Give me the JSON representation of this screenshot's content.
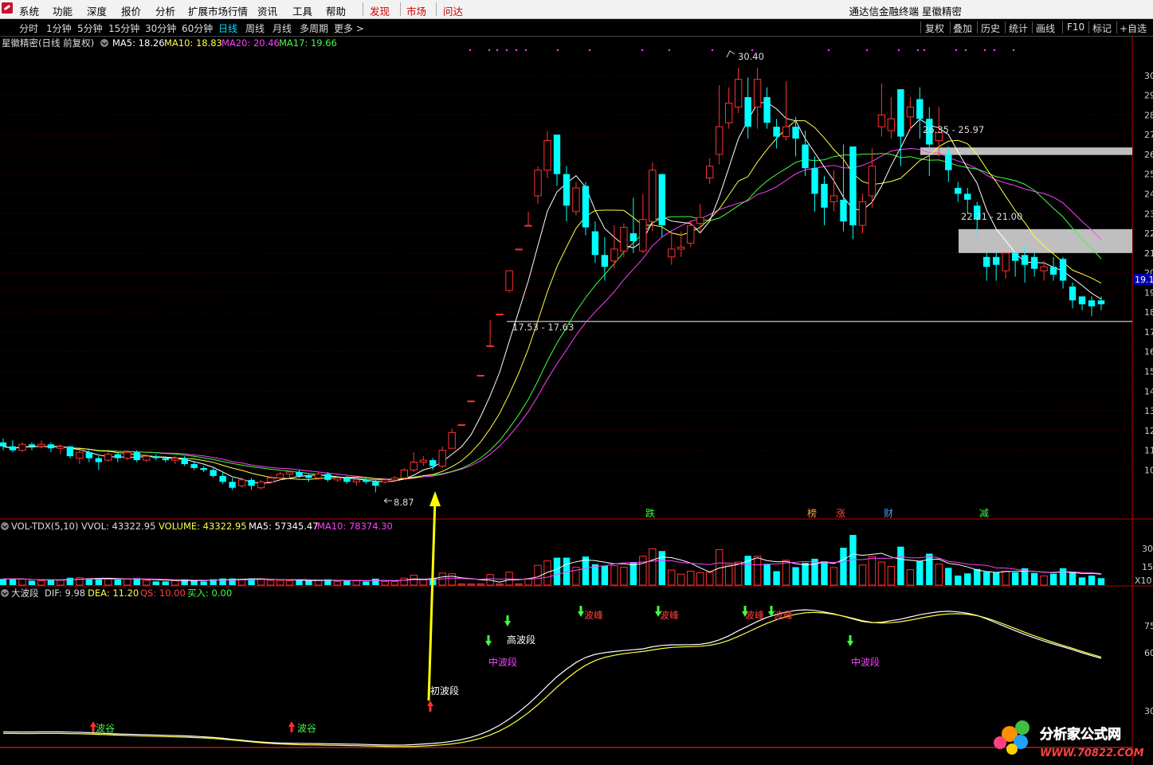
{
  "menu": {
    "items": [
      "系统",
      "功能",
      "深度",
      "报价",
      "分析",
      "扩展市场行情",
      "资讯",
      "工具",
      "帮助"
    ],
    "red_items": [
      "发现",
      "市场",
      "问达"
    ],
    "title": "通达信金融终端 星徽精密"
  },
  "periods": [
    "分时",
    "1分钟",
    "5分钟",
    "15分钟",
    "30分钟",
    "60分钟",
    "日线",
    "周线",
    "月线",
    "多周期",
    "更多 >"
  ],
  "active_period": "日线",
  "toolbar": [
    "复权",
    "叠加",
    "历史",
    "统计",
    "画线",
    "F10",
    "标记",
    "+自选"
  ],
  "main_chart": {
    "title": "星徽精密(日线 前复权)",
    "legend": [
      {
        "label": "MA5: 18.26",
        "color": "#ffffff"
      },
      {
        "label": "MA10: 18.83",
        "color": "#ffff40"
      },
      {
        "label": "MA20: 20.46",
        "color": "#ff40ff"
      },
      {
        "label": "MA17: 19.66",
        "color": "#40ff40"
      }
    ],
    "annotations": {
      "high": "30.40",
      "low": "8.87",
      "zone1": "26.35 - 25.97",
      "zone2": "22.21 - 21.00",
      "zone3": "17.53 - 17.63"
    },
    "current_price": "19.1",
    "y_ticks": [
      "30",
      "29",
      "28",
      "27",
      "26",
      "25",
      "24",
      "23",
      "22",
      "21",
      "20",
      "19",
      "18",
      "17",
      "16",
      "15",
      "14",
      "13",
      "12",
      "11",
      "10"
    ],
    "events": [
      {
        "label": "跌",
        "color": "#40ff40"
      },
      {
        "label": "榜",
        "color": "#ffa040"
      },
      {
        "label": "涨",
        "color": "#ff4040"
      },
      {
        "label": "财",
        "color": "#40a0ff"
      },
      {
        "label": "减",
        "color": "#40ff40"
      }
    ]
  },
  "volume_panel": {
    "name": "VOL-TDX(5,10)",
    "legend": [
      {
        "label": "VVOL: 43322.95",
        "color": "#dddddd"
      },
      {
        "label": "VOLUME: 43322.95",
        "color": "#ffff40"
      },
      {
        "label": "MA5: 57345.47",
        "color": "#ffffff"
      },
      {
        "label": "MA10: 78374.30",
        "color": "#ff40ff"
      }
    ],
    "y_ticks": [
      "30",
      "15",
      "X10"
    ]
  },
  "wave_panel": {
    "name": "大波段",
    "legend": [
      {
        "label": "DIF: 9.98",
        "color": "#dddddd"
      },
      {
        "label": "DEA: 11.20",
        "color": "#ffff40"
      },
      {
        "label": "QS: 10.00",
        "color": "#ff4040"
      },
      {
        "label": "买入: 0.00",
        "color": "#40ff40"
      }
    ],
    "labels": {
      "trough": "波谷",
      "peak": "波峰",
      "initial": "初波段",
      "middle": "中波段",
      "high": "高波段"
    },
    "y_ticks": [
      "75",
      "60",
      "30"
    ]
  },
  "watermark": {
    "name": "分析家公式网",
    "url": "WWW.70822.COM"
  },
  "chart_data": {
    "type": "candlestick",
    "title": "星徽精密(日线 前复权)",
    "ylim": [
      8,
      31
    ],
    "candles": [
      [
        11.4,
        11.2,
        11.6,
        11.0
      ],
      [
        11.2,
        11.0,
        11.5,
        10.9
      ],
      [
        11.0,
        11.3,
        11.4,
        10.9
      ],
      [
        11.3,
        11.2,
        11.4,
        11.0
      ],
      [
        11.2,
        11.3,
        11.5,
        11.1
      ],
      [
        11.3,
        11.1,
        11.4,
        10.9
      ],
      [
        11.1,
        11.2,
        11.3,
        10.8
      ],
      [
        11.2,
        10.7,
        11.2,
        10.6
      ],
      [
        10.6,
        10.9,
        11.0,
        10.3
      ],
      [
        10.9,
        10.6,
        11.0,
        10.4
      ],
      [
        10.6,
        10.4,
        10.7,
        10.0
      ],
      [
        10.5,
        10.8,
        10.9,
        10.4
      ],
      [
        10.8,
        10.6,
        10.9,
        10.4
      ],
      [
        10.6,
        10.9,
        11.0,
        10.5
      ],
      [
        10.9,
        10.5,
        11.0,
        10.4
      ],
      [
        10.5,
        10.7,
        10.8,
        10.4
      ],
      [
        10.7,
        10.6,
        10.8,
        10.5
      ],
      [
        10.6,
        10.5,
        10.7,
        10.4
      ],
      [
        10.5,
        10.6,
        10.7,
        10.3
      ],
      [
        10.6,
        10.3,
        10.7,
        10.2
      ],
      [
        10.3,
        10.1,
        10.4,
        10.0
      ],
      [
        10.1,
        10.0,
        10.2,
        9.9
      ],
      [
        10.0,
        9.7,
        10.1,
        9.6
      ],
      [
        9.7,
        9.4,
        9.9,
        9.3
      ],
      [
        9.4,
        9.1,
        9.6,
        9.0
      ],
      [
        9.2,
        9.5,
        9.6,
        9.1
      ],
      [
        9.5,
        9.2,
        9.6,
        9.0
      ],
      [
        9.1,
        9.4,
        9.5,
        9.0
      ],
      [
        9.4,
        9.6,
        9.7,
        9.3
      ],
      [
        9.6,
        9.8,
        9.9,
        9.5
      ],
      [
        9.8,
        9.9,
        10.0,
        9.6
      ],
      [
        9.9,
        9.7,
        10.0,
        9.6
      ],
      [
        9.7,
        9.6,
        9.8,
        9.4
      ],
      [
        9.6,
        9.8,
        9.9,
        9.5
      ],
      [
        9.8,
        9.5,
        9.9,
        9.4
      ],
      [
        9.5,
        9.6,
        9.7,
        9.4
      ],
      [
        9.6,
        9.4,
        9.7,
        9.3
      ],
      [
        9.4,
        9.5,
        9.6,
        9.2
      ],
      [
        9.5,
        9.4,
        9.6,
        9.3
      ],
      [
        9.4,
        9.2,
        9.5,
        8.87
      ],
      [
        9.4,
        9.5,
        9.6,
        9.3
      ],
      [
        9.5,
        9.6,
        9.7,
        9.4
      ],
      [
        9.6,
        10.0,
        10.1,
        9.5
      ],
      [
        10.0,
        10.4,
        10.9,
        9.9
      ],
      [
        10.4,
        10.5,
        10.7,
        10.2
      ],
      [
        10.5,
        10.2,
        10.6,
        10.0
      ],
      [
        10.2,
        11.0,
        11.2,
        10.1
      ],
      [
        11.1,
        11.9,
        12.1,
        11.1
      ],
      [
        12.3,
        12.3,
        12.3,
        12.3
      ],
      [
        13.5,
        13.5,
        13.5,
        13.5
      ],
      [
        14.8,
        14.8,
        14.8,
        14.8
      ],
      [
        16.3,
        16.3,
        17.6,
        16.3
      ],
      [
        17.9,
        17.9,
        17.9,
        17.9
      ],
      [
        19.1,
        20.1,
        20.1,
        19.0
      ],
      [
        21.2,
        21.2,
        21.2,
        21.2
      ],
      [
        22.4,
        22.4,
        23.1,
        22.4
      ],
      [
        23.9,
        25.2,
        25.4,
        23.5
      ],
      [
        25.2,
        26.7,
        27.2,
        24.8
      ],
      [
        27.0,
        25.0,
        27.0,
        24.4
      ],
      [
        25.0,
        23.4,
        25.4,
        22.6
      ],
      [
        23.1,
        24.3,
        24.6,
        22.9
      ],
      [
        24.4,
        22.3,
        24.6,
        21.9
      ],
      [
        22.1,
        20.9,
        22.6,
        20.5
      ],
      [
        20.9,
        20.3,
        21.8,
        19.6
      ],
      [
        20.6,
        21.2,
        22.4,
        20.2
      ],
      [
        21.1,
        22.3,
        22.5,
        20.8
      ],
      [
        22.0,
        21.6,
        23.8,
        21.0
      ],
      [
        21.1,
        22.7,
        24.0,
        21.0
      ],
      [
        22.6,
        25.2,
        25.6,
        22.1
      ],
      [
        25.0,
        22.4,
        25.0,
        21.8
      ],
      [
        20.8,
        21.2,
        22.1,
        20.4
      ],
      [
        21.2,
        21.3,
        22.1,
        20.8
      ],
      [
        21.5,
        22.4,
        22.6,
        21.3
      ],
      [
        22.5,
        22.8,
        23.5,
        22.1
      ],
      [
        24.8,
        25.4,
        25.8,
        24.5
      ],
      [
        26.0,
        27.4,
        29.5,
        25.5
      ],
      [
        27.6,
        28.6,
        29.4,
        27.3
      ],
      [
        28.4,
        29.8,
        30.4,
        28.1
      ],
      [
        28.9,
        27.4,
        29.9,
        26.8
      ],
      [
        28.4,
        29.8,
        30.4,
        27.3
      ],
      [
        28.9,
        27.6,
        29.4,
        27.3
      ],
      [
        27.4,
        26.9,
        27.8,
        26.3
      ],
      [
        26.9,
        27.4,
        29.7,
        26.7
      ],
      [
        27.4,
        26.8,
        27.9,
        25.9
      ],
      [
        26.5,
        25.3,
        27.2,
        24.9
      ],
      [
        25.3,
        24.0,
        25.9,
        23.1
      ],
      [
        24.5,
        23.3,
        24.9,
        22.4
      ],
      [
        23.6,
        23.9,
        25.2,
        23.1
      ],
      [
        23.7,
        22.6,
        26.5,
        22.1
      ],
      [
        26.4,
        22.4,
        26.4,
        21.7
      ],
      [
        22.4,
        23.6,
        24.0,
        22.0
      ],
      [
        23.9,
        25.4,
        26.3,
        23.3
      ],
      [
        27.4,
        28.0,
        29.6,
        26.9
      ],
      [
        27.2,
        27.8,
        28.9,
        26.8
      ],
      [
        29.3,
        26.9,
        29.3,
        25.4
      ],
      [
        27.9,
        28.4,
        28.9,
        27.2
      ],
      [
        28.8,
        27.8,
        29.4,
        26.8
      ],
      [
        27.8,
        26.5,
        28.4,
        24.9
      ],
      [
        26.7,
        27.1,
        28.4,
        25.9
      ],
      [
        26.0,
        25.2,
        26.4,
        24.6
      ],
      [
        24.3,
        24.0,
        24.6,
        23.6
      ],
      [
        24.0,
        23.7,
        24.3,
        23.0
      ],
      [
        23.4,
        22.7,
        23.6,
        21.9
      ],
      [
        20.8,
        20.3,
        21.0,
        19.6
      ],
      [
        20.8,
        20.4,
        21.0,
        19.6
      ],
      [
        20.1,
        21.0,
        21.0,
        19.7
      ],
      [
        21.0,
        20.6,
        21.2,
        19.8
      ],
      [
        20.9,
        20.4,
        21.4,
        19.5
      ],
      [
        20.8,
        20.2,
        21.0,
        19.8
      ],
      [
        20.1,
        20.3,
        20.6,
        19.6
      ],
      [
        20.3,
        19.9,
        20.8,
        19.6
      ],
      [
        20.7,
        19.6,
        20.8,
        19.2
      ],
      [
        19.3,
        18.6,
        19.5,
        18.2
      ],
      [
        18.8,
        18.4,
        18.8,
        18.1
      ],
      [
        18.6,
        18.3,
        18.8,
        17.8
      ],
      [
        18.6,
        18.4,
        18.8,
        18.1
      ]
    ]
  }
}
